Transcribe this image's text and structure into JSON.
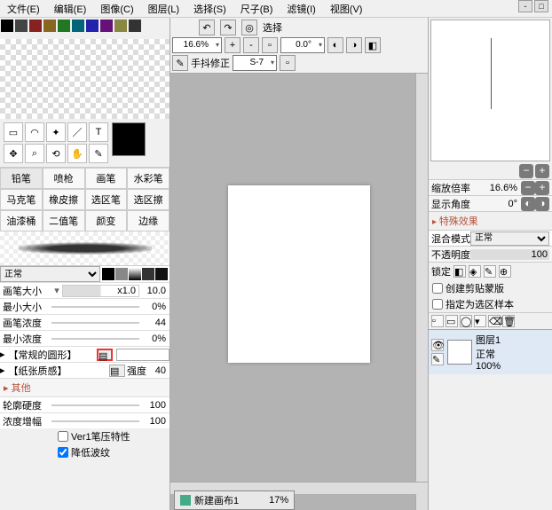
{
  "menu": {
    "file": "文件(E)",
    "edit": "编辑(E)",
    "image": "图像(C)",
    "layer": "图层(L)",
    "select": "选择(S)",
    "ruler": "尺子(B)",
    "filter": "滤镜(I)",
    "view": "视图(V)"
  },
  "sel_label": "选择",
  "zoom": "16.6%",
  "angle": "0.0°",
  "stabilizer_label": "手抖修正",
  "stabilizer_val": "S-7",
  "brush_tabs": {
    "r1c1": "铅笔",
    "r1c2": "喷枪",
    "r1c3": "画笔",
    "r1c4": "水彩笔",
    "r2c1": "马克笔",
    "r2c2": "橡皮擦",
    "r2c3": "选区笔",
    "r2c4": "选区擦",
    "r3c1": "油漆桶",
    "r3c2": "二值笔",
    "r3c3": "颜变",
    "r3c4": "边缘"
  },
  "blend_mode": "正常",
  "brush_size_label": "画笔大小",
  "brush_size_val": "10.0",
  "brush_size_x": "x1.0",
  "min_size_label": "最小大小",
  "min_size_val": "0%",
  "brush_density_label": "画笔浓度",
  "brush_density_val": "44",
  "min_density_label": "最小浓度",
  "min_density_val": "0%",
  "tex_shape": "【常规的圆形】",
  "tex_paper": "【纸张质感】",
  "tex_intensity_label": "强度",
  "tex_intensity_val": "40",
  "other_label": "其他",
  "edge_hard_label": "轮廓硬度",
  "edge_hard_val": "100",
  "density_gain_label": "浓度增幅",
  "density_gain_val": "100",
  "check1": "Ver1笔压特性",
  "check2": "降低波纹",
  "doc_name": "新建画布1",
  "doc_zoom": "17%",
  "right": {
    "zoom_label": "缩放倍率",
    "zoom_val": "16.6%",
    "angle_label": "显示角度",
    "angle_val": "0°",
    "fx_label": "特殊效果",
    "blend_label": "混合模式",
    "blend_val": "正常",
    "opacity_label": "不透明度",
    "opacity_val": "100",
    "lock_label": "锁定",
    "clip_label": "创建剪贴蒙版",
    "mask_label": "指定为选区样本",
    "layer_name": "图层1",
    "layer_mode": "正常",
    "layer_opacity": "100%"
  }
}
